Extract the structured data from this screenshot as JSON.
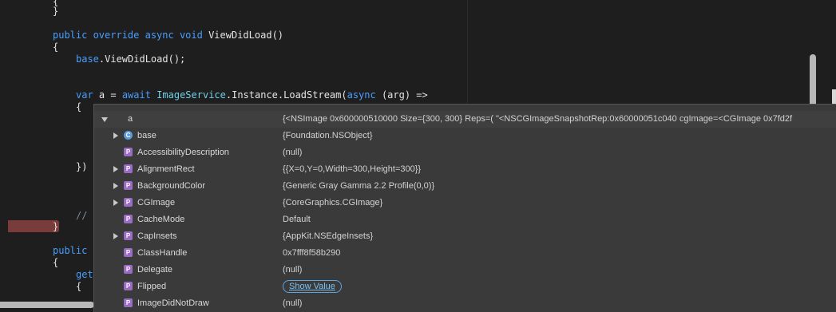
{
  "editor": {
    "lines": [
      {
        "text": "{"
      },
      {
        "text": "}"
      },
      {
        "kw1": "public override async void ",
        "name": "ViewDidLoad",
        "rest": "()"
      },
      {
        "text": "{"
      },
      {
        "pre": "base",
        "rest": ".ViewDidLoad();"
      },
      {
        "var": "var",
        "a": " a = ",
        "await": "await ",
        "cls": "ImageService",
        "rest": ".Instance.LoadStream(",
        "async": "async",
        "tail": " (arg) =>"
      },
      {
        "text": "{"
      },
      {
        "text": "})"
      },
      {
        "text": "// "
      },
      {
        "text": "}"
      },
      {
        "text": "public "
      },
      {
        "text": "{"
      },
      {
        "text": "get"
      },
      {
        "text": "{"
      }
    ]
  },
  "datatip": {
    "root": {
      "name": "a",
      "value": "{<NSImage 0x600000510000 Size={300, 300} Reps=(     \"<NSCGImageSnapshotRep:0x60000051c040 cgImage=<CGImage 0x7fd2f"
    },
    "rows": [
      {
        "name": "base",
        "value": "{Foundation.NSObject}",
        "expandable": true,
        "icon": "class-icon"
      },
      {
        "name": "AccessibilityDescription",
        "value": "(null)",
        "expandable": false,
        "icon": "property-icon"
      },
      {
        "name": "AlignmentRect",
        "value": "{{X=0,Y=0,Width=300,Height=300}}",
        "expandable": true,
        "icon": "property-icon"
      },
      {
        "name": "BackgroundColor",
        "value": "{Generic Gray Gamma 2.2 Profile(0,0)}",
        "expandable": true,
        "icon": "property-icon"
      },
      {
        "name": "CGImage",
        "value": "{CoreGraphics.CGImage}",
        "expandable": true,
        "icon": "property-icon"
      },
      {
        "name": "CacheMode",
        "value": "Default",
        "expandable": false,
        "icon": "property-icon"
      },
      {
        "name": "CapInsets",
        "value": "{AppKit.NSEdgeInsets}",
        "expandable": true,
        "icon": "property-icon"
      },
      {
        "name": "ClassHandle",
        "value": "0x7fff8f58b290",
        "expandable": false,
        "icon": "property-icon"
      },
      {
        "name": "Delegate",
        "value": "(null)",
        "expandable": false,
        "icon": "property-icon"
      },
      {
        "name": "Flipped",
        "value": "Show Value",
        "expandable": false,
        "icon": "property-icon",
        "button": true
      },
      {
        "name": "ImageDidNotDraw",
        "value": "(null)",
        "expandable": false,
        "icon": "property-icon"
      }
    ],
    "icon_letters": {
      "property": "P",
      "class": "C"
    }
  },
  "colors": {
    "background": "#1e1e1e",
    "keyword": "#4a9eff",
    "type": "#6fd0e8",
    "breakpoint": "#7a3b3b",
    "datatip_bg": "#3a3a3a",
    "property_icon": "#9b6cc3",
    "link": "#7cc0f2"
  }
}
